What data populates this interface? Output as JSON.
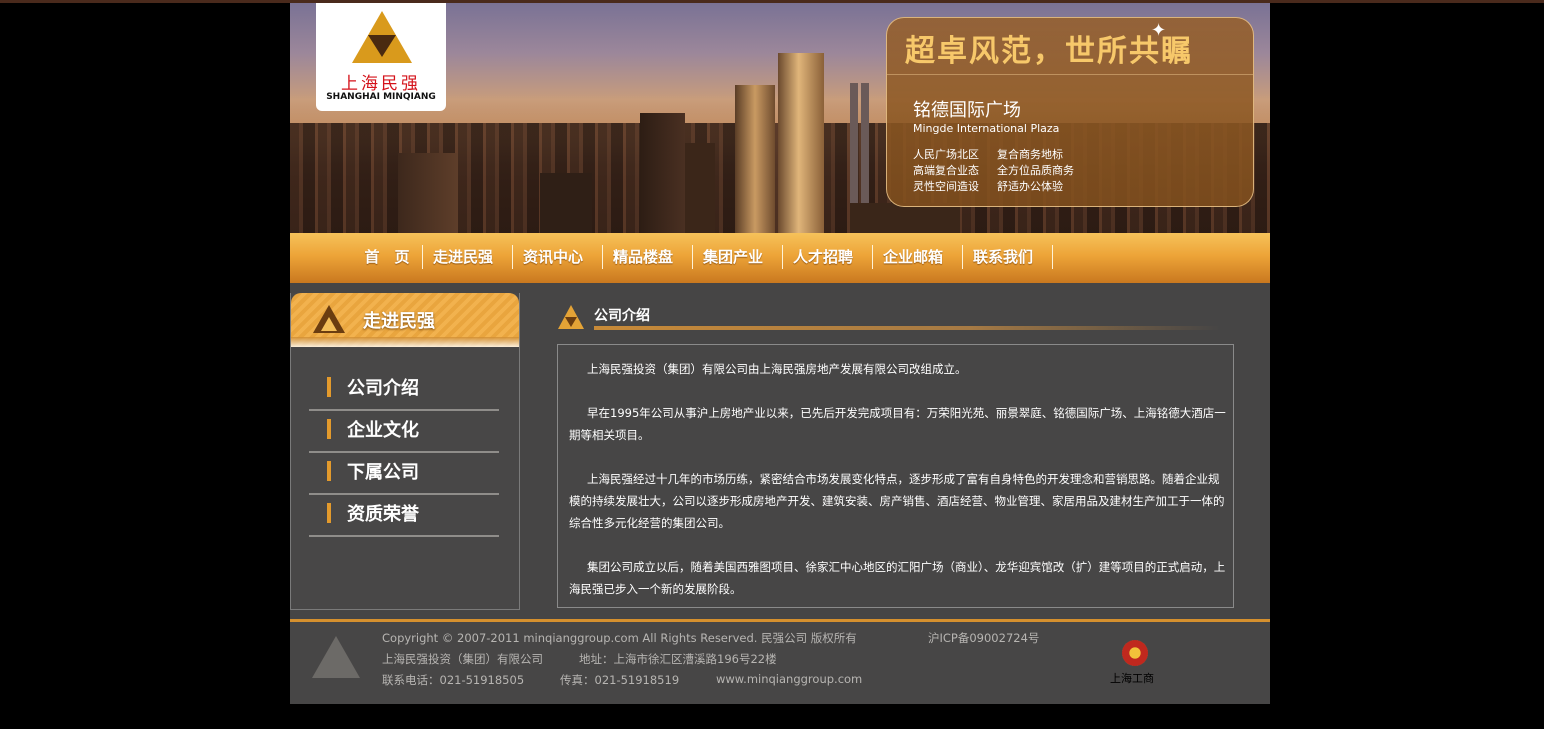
{
  "logo": {
    "name_cn": "上海民强",
    "name_en": "SHANGHAI MINQIANG"
  },
  "promo": {
    "slogan": "超卓风范，世所共瞩",
    "title": "铭德国际广场",
    "title_en": "Mingde International Plaza",
    "features": [
      {
        "a": "人民广场北区",
        "b": "复合商务地标"
      },
      {
        "a": "高端复合业态",
        "b": "全方位品质商务"
      },
      {
        "a": "灵性空间造设",
        "b": "舒适办公体验"
      }
    ]
  },
  "nav": {
    "items": [
      "首　页",
      "走进民强",
      "资讯中心",
      "精品楼盘",
      "集团产业",
      "人才招聘",
      "企业邮箱",
      "联系我们"
    ]
  },
  "sidebar": {
    "title": "走进民强",
    "items": [
      "公司介绍",
      "企业文化",
      "下属公司",
      "资质荣誉"
    ]
  },
  "section": {
    "title": "公司介绍",
    "paragraphs": [
      "上海民强投资（集团）有限公司由上海民强房地产发展有限公司改组成立。",
      "早在1995年公司从事沪上房地产业以来，已先后开发完成项目有：万荣阳光苑、丽景翠庭、铭德国际广场、上海铭德大酒店一期等相关项目。",
      "上海民强经过十几年的市场历练，紧密结合市场发展变化特点，逐步形成了富有自身特色的开发理念和营销思路。随着企业规模的持续发展壮大，公司以逐步形成房地产开发、建筑安装、房产销售、酒店经营、物业管理、家居用品及建材生产加工于一体的综合性多元化经营的集团公司。",
      "集团公司成立以后，随着美国西雅图项目、徐家汇中心地区的汇阳广场（商业）、龙华迎宾馆改（扩）建等项目的正式启动，上海民强已步入一个新的发展阶段。"
    ]
  },
  "footer": {
    "copyright": "Copyright © 2007-2011 minqianggroup.com All Rights Reserved. 民强公司  版权所有",
    "icp": "沪ICP备09002724号",
    "company": "上海民强投资（集团）有限公司",
    "address": "地址：上海市徐汇区漕溪路196号22楼",
    "phone": "联系电话：021-51918505",
    "fax": "传真：021-51918519",
    "website": "www.minqianggroup.com",
    "badge_label": "上海工商"
  },
  "colors": {
    "accent": "#eda438",
    "background": "#464545"
  }
}
